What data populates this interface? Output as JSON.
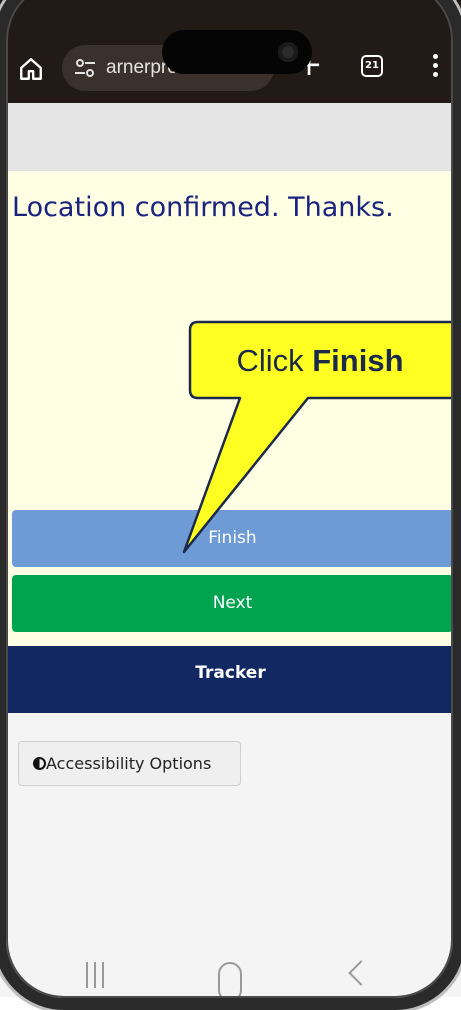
{
  "browser": {
    "url_text": "arnerprofile.com",
    "tab_count": "21",
    "new_tab_label": "+"
  },
  "page": {
    "message": "Location confirmed. Thanks.",
    "finish_label": "Finish",
    "next_label": "Next",
    "tracker_label": "Tracker",
    "accessibility_label": "Accessibility Options"
  },
  "callout": {
    "prefix": "Click ",
    "target": "Finish"
  },
  "colors": {
    "content_bg": "#ffffe3",
    "finish_button": "#6e9bd6",
    "next_button": "#00a34f",
    "tracker_bar": "#122863",
    "message_text": "#1a237e",
    "callout_fill": "#ffff22",
    "browser_chrome": "#211a17"
  },
  "icons": {
    "home": "home-icon",
    "site_settings": "tune-icon",
    "new_tab": "plus-icon",
    "tabs": "tab-switcher-icon",
    "menu": "more-vert-icon",
    "accessibility": "contrast-icon"
  }
}
